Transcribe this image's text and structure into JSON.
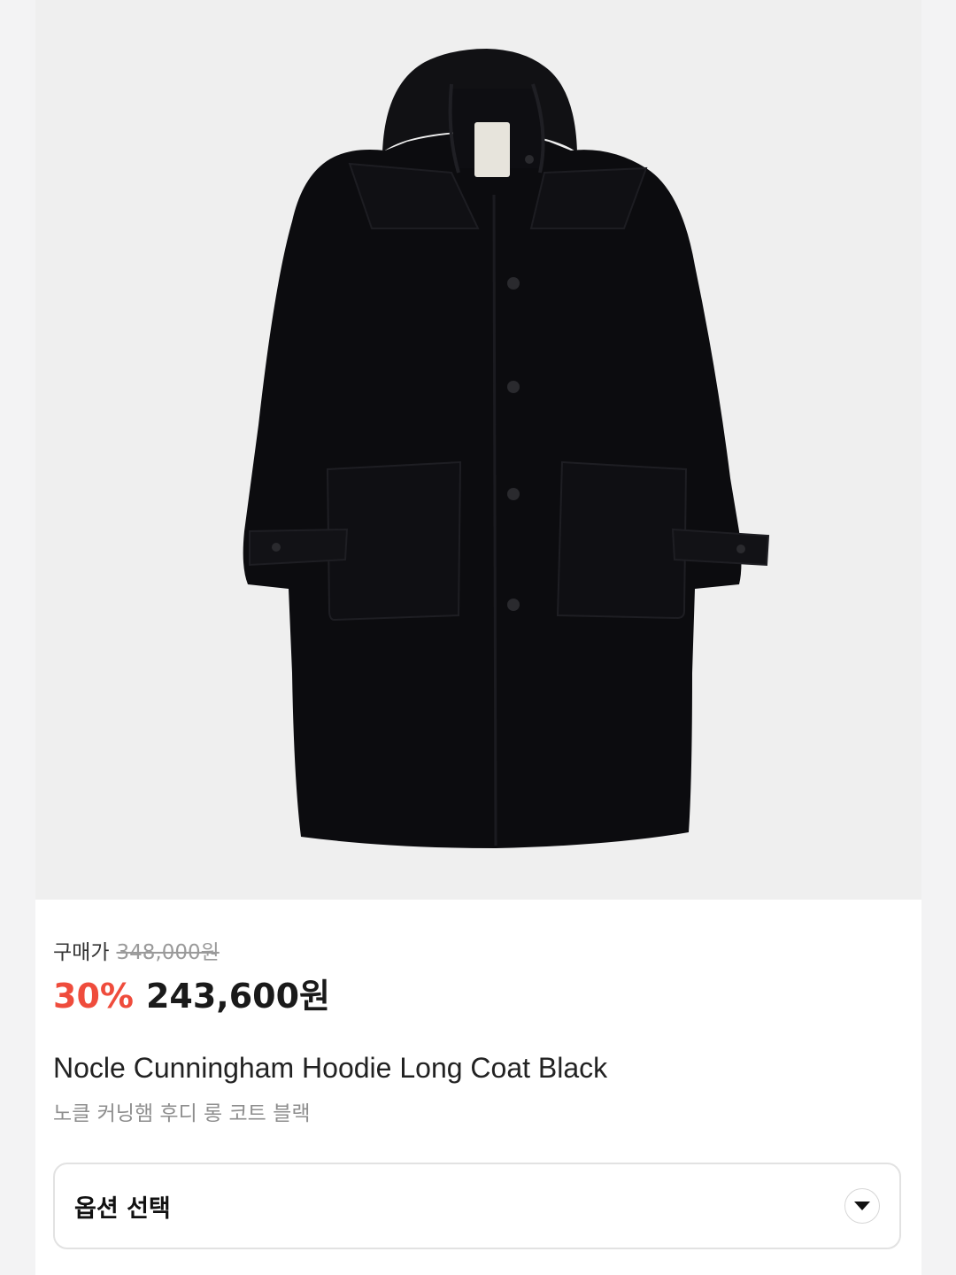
{
  "product": {
    "image": "black hooded duffle coat",
    "price_label": "구매가",
    "original_price": "348,000원",
    "discount": "30%",
    "sale_price": "243,600원",
    "name_en": "Nocle Cunningham Hoodie Long Coat Black",
    "name_ko": "노클 커닝햄 후디 롱 코트 블랙"
  },
  "option": {
    "label": "옵션 선택",
    "icon": "chevron-down-icon"
  },
  "colors": {
    "discount": "#ef4c3c",
    "background": "#efefef"
  }
}
